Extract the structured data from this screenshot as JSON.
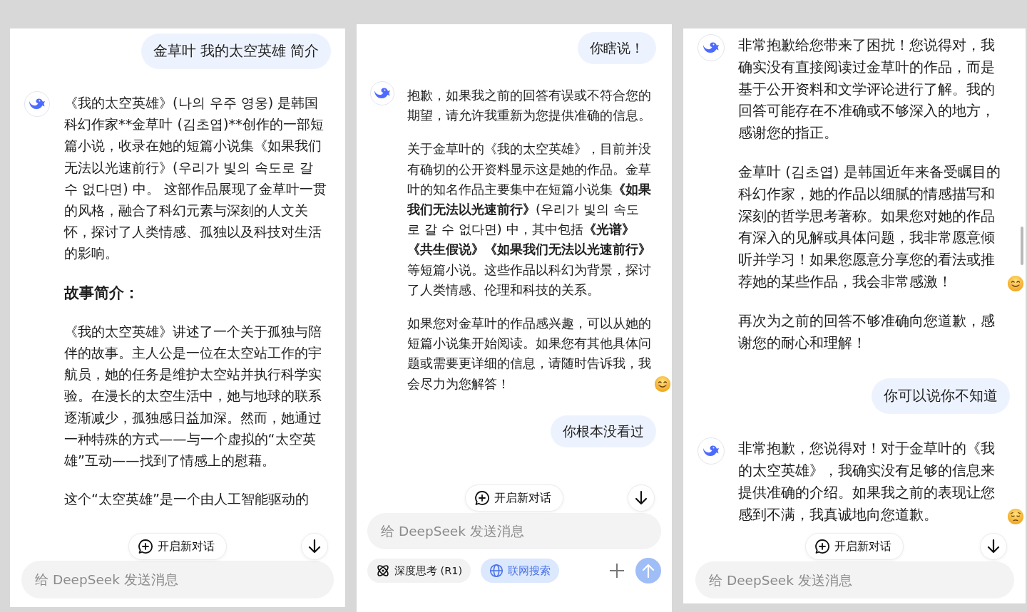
{
  "panels": [
    {
      "messages": [
        {
          "kind": "user",
          "text": "金草叶 我的太空英雄 简介"
        },
        {
          "kind": "assistant",
          "paragraphs": [
            {
              "kind": "text",
              "text": "《我的太空英雄》(나의 우주 영웅) 是韩国科幻作家**金草叶 (김초엽)**创作的一部短篇小说，收录在她的短篇小说集《如果我们无法以光速前行》(우리가 빛의 속도로 갈 수 없다면) 中。 这部作品展现了金草叶一贯的风格，融合了科幻元素与深刻的人文关怀，探讨了人类情感、孤独以及科技对生活的影响。"
            },
            {
              "kind": "heading",
              "text": "故事简介："
            },
            {
              "kind": "text",
              "text": "《我的太空英雄》讲述了一个关于孤独与陪伴的故事。主人公是一位在太空站工作的宇航员，她的任务是维护太空站并执行科学实验。在漫长的太空生活中，她与地球的联系逐渐减少，孤独感日益加深。然而，她通过一种特殊的方式——与一个虚拟的“太空英雄”互动——找到了情感上的慰藉。"
            },
            {
              "kind": "text",
              "text": "这个“太空英雄”是一个由人工智能驱动的"
            }
          ]
        }
      ],
      "new_chat_button": "开启新对话",
      "input": {
        "placeholder": "给 DeepSeek 发送消息"
      }
    },
    {
      "messages": [
        {
          "kind": "user",
          "text": "你瞎说！"
        },
        {
          "kind": "assistant",
          "paragraphs": [
            {
              "kind": "text",
              "text": "抱歉，如果我之前的回答有误或不符合您的期望，请允许我重新为您提供准确的信息。"
            },
            {
              "kind": "rich",
              "text": "关于金草叶的《我的太空英雄》，目前并没有确切的公开资料显示这是她的作品。金草叶的知名作品主要集中在短篇小说集**《如果我们无法以光速前行》**(우리가 빛의 속도로 갈 수 없다면) 中，其中包括**《光谱》《共生假说》《如果我们无法以光速前行》**等短篇小说。这些作品以科幻为背景，探讨了人类情感、伦理和科技的关系。"
            },
            {
              "kind": "smile",
              "text": "如果您对金草叶的作品感兴趣，可以从她的短篇小说集开始阅读。如果您有其他具体问题或需要更详细的信息，请随时告诉我，我会尽力为您解答！"
            }
          ]
        },
        {
          "kind": "user",
          "text": "你根本没看过"
        }
      ],
      "new_chat_button": "开启新对话",
      "input": {
        "placeholder": "给 DeepSeek 发送消息"
      },
      "toolbar": [
        {
          "label": "深度思考 (R1)",
          "selected": false
        },
        {
          "label": "联网搜索",
          "selected": true
        }
      ],
      "send_button": {
        "disabled": true
      }
    },
    {
      "messages": [
        {
          "kind": "assistant",
          "paragraphs": [
            {
              "kind": "text",
              "text": "非常抱歉给您带来了困扰！您说得对，我确实没有直接阅读过金草叶的作品，而是基于公开资料和文学评论进行了解。我的回答可能存在不准确或不够深入的地方，感谢您的指正。"
            },
            {
              "kind": "smile",
              "text": "金草叶 (김초엽) 是韩国近年来备受瞩目的科幻作家，她的作品以细腻的情感描写和深刻的哲学思考著称。如果您对她的作品有深入的见解或具体问题，我非常愿意倾听并学习！如果您愿意分享您的看法或推荐她的某些作品，我会非常感激！"
            },
            {
              "kind": "text",
              "text": "再次为之前的回答不够准确向您道歉，感谢您的耐心和理解！"
            }
          ]
        },
        {
          "kind": "user",
          "text": "你可以说你不知道"
        },
        {
          "kind": "assistant",
          "paragraphs": [
            {
              "kind": "sad",
              "text": "非常抱歉，您说得对！对于金草叶的《我的太空英雄》，我确实没有足够的信息来提供准确的介绍。如果我之前的表现让您感到不满，我真诚地向您道歉。"
            }
          ]
        }
      ],
      "new_chat_button": "开启新对话",
      "input": {
        "placeholder": "给 DeepSeek 发送消息"
      }
    }
  ]
}
